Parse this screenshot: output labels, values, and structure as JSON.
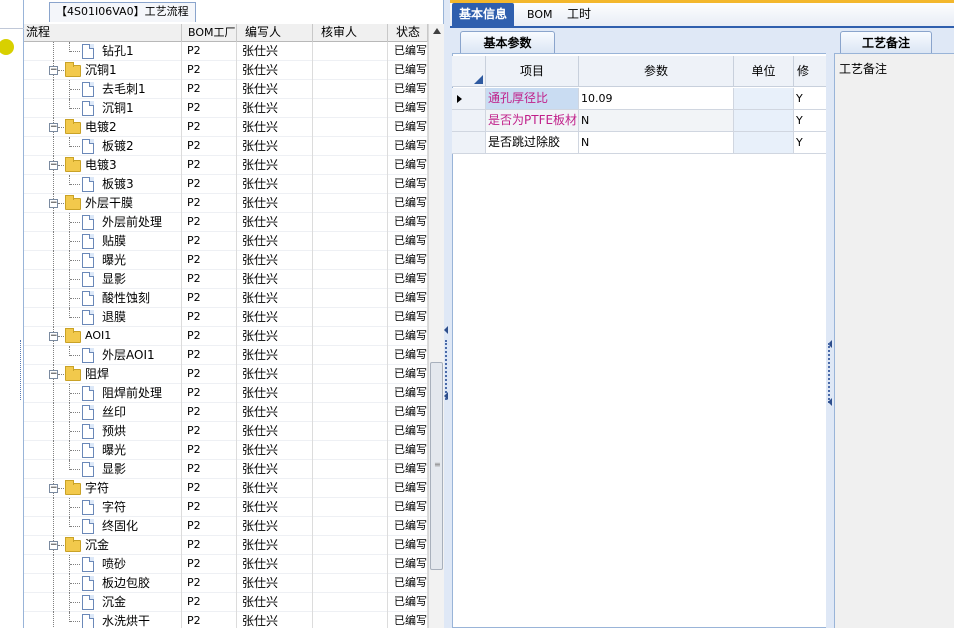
{
  "tree": {
    "tab_title": "【4S01I06VA0】工艺流程",
    "columns": {
      "flow": "流程",
      "bom": "BOM工厂",
      "writer": "编写人",
      "reviewer": "核审人",
      "status": "状态"
    },
    "rows": [
      {
        "label": "钻孔1",
        "level": 2,
        "type": "doc",
        "bom": "P2",
        "writer": "张仕兴",
        "reviewer": "",
        "status": "已编写",
        "latin": false
      },
      {
        "label": "沉铜1",
        "level": 1,
        "type": "folder",
        "bom": "P2",
        "writer": "张仕兴",
        "reviewer": "",
        "status": "已编写",
        "latin": false
      },
      {
        "label": "去毛刺1",
        "level": 2,
        "type": "doc",
        "bom": "P2",
        "writer": "张仕兴",
        "reviewer": "",
        "status": "已编写",
        "latin": false
      },
      {
        "label": "沉铜1",
        "level": 2,
        "type": "doc",
        "bom": "P2",
        "writer": "张仕兴",
        "reviewer": "",
        "status": "已编写",
        "latin": false
      },
      {
        "label": "电镀2",
        "level": 1,
        "type": "folder",
        "bom": "P2",
        "writer": "张仕兴",
        "reviewer": "",
        "status": "已编写",
        "latin": false
      },
      {
        "label": "板镀2",
        "level": 2,
        "type": "doc",
        "bom": "P2",
        "writer": "张仕兴",
        "reviewer": "",
        "status": "已编写",
        "latin": false
      },
      {
        "label": "电镀3",
        "level": 1,
        "type": "folder",
        "bom": "P2",
        "writer": "张仕兴",
        "reviewer": "",
        "status": "已编写",
        "latin": false
      },
      {
        "label": "板镀3",
        "level": 2,
        "type": "doc",
        "bom": "P2",
        "writer": "张仕兴",
        "reviewer": "",
        "status": "已编写",
        "latin": false
      },
      {
        "label": "外层干膜",
        "level": 1,
        "type": "folder",
        "bom": "P2",
        "writer": "张仕兴",
        "reviewer": "",
        "status": "已编写",
        "latin": false
      },
      {
        "label": "外层前处理",
        "level": 2,
        "type": "doc",
        "bom": "P2",
        "writer": "张仕兴",
        "reviewer": "",
        "status": "已编写",
        "latin": false
      },
      {
        "label": "贴膜",
        "level": 2,
        "type": "doc",
        "bom": "P2",
        "writer": "张仕兴",
        "reviewer": "",
        "status": "已编写",
        "latin": false
      },
      {
        "label": "曝光",
        "level": 2,
        "type": "doc",
        "bom": "P2",
        "writer": "张仕兴",
        "reviewer": "",
        "status": "已编写",
        "latin": false
      },
      {
        "label": "显影",
        "level": 2,
        "type": "doc",
        "bom": "P2",
        "writer": "张仕兴",
        "reviewer": "",
        "status": "已编写",
        "latin": false
      },
      {
        "label": "酸性蚀刻",
        "level": 2,
        "type": "doc",
        "bom": "P2",
        "writer": "张仕兴",
        "reviewer": "",
        "status": "已编写",
        "latin": false
      },
      {
        "label": "退膜",
        "level": 2,
        "type": "doc",
        "bom": "P2",
        "writer": "张仕兴",
        "reviewer": "",
        "status": "已编写",
        "latin": false
      },
      {
        "label": "AOI1",
        "level": 1,
        "type": "folder",
        "bom": "P2",
        "writer": "张仕兴",
        "reviewer": "",
        "status": "已编写",
        "latin": true
      },
      {
        "label": "外层AOI1",
        "level": 2,
        "type": "doc",
        "bom": "P2",
        "writer": "张仕兴",
        "reviewer": "",
        "status": "已编写",
        "latin": false
      },
      {
        "label": "阻焊",
        "level": 1,
        "type": "folder",
        "bom": "P2",
        "writer": "张仕兴",
        "reviewer": "",
        "status": "已编写",
        "latin": false
      },
      {
        "label": "阻焊前处理",
        "level": 2,
        "type": "doc",
        "bom": "P2",
        "writer": "张仕兴",
        "reviewer": "",
        "status": "已编写",
        "latin": false
      },
      {
        "label": "丝印",
        "level": 2,
        "type": "doc",
        "bom": "P2",
        "writer": "张仕兴",
        "reviewer": "",
        "status": "已编写",
        "latin": false
      },
      {
        "label": "预烘",
        "level": 2,
        "type": "doc",
        "bom": "P2",
        "writer": "张仕兴",
        "reviewer": "",
        "status": "已编写",
        "latin": false
      },
      {
        "label": "曝光",
        "level": 2,
        "type": "doc",
        "bom": "P2",
        "writer": "张仕兴",
        "reviewer": "",
        "status": "已编写",
        "latin": false
      },
      {
        "label": "显影",
        "level": 2,
        "type": "doc",
        "bom": "P2",
        "writer": "张仕兴",
        "reviewer": "",
        "status": "已编写",
        "latin": false
      },
      {
        "label": "字符",
        "level": 1,
        "type": "folder",
        "bom": "P2",
        "writer": "张仕兴",
        "reviewer": "",
        "status": "已编写",
        "latin": false
      },
      {
        "label": "字符",
        "level": 2,
        "type": "doc",
        "bom": "P2",
        "writer": "张仕兴",
        "reviewer": "",
        "status": "已编写",
        "latin": false
      },
      {
        "label": "终固化",
        "level": 2,
        "type": "doc",
        "bom": "P2",
        "writer": "张仕兴",
        "reviewer": "",
        "status": "已编写",
        "latin": false
      },
      {
        "label": "沉金",
        "level": 1,
        "type": "folder",
        "bom": "P2",
        "writer": "张仕兴",
        "reviewer": "",
        "status": "已编写",
        "latin": false
      },
      {
        "label": "喷砂",
        "level": 2,
        "type": "doc",
        "bom": "P2",
        "writer": "张仕兴",
        "reviewer": "",
        "status": "已编写",
        "latin": false
      },
      {
        "label": "板边包胶",
        "level": 2,
        "type": "doc",
        "bom": "P2",
        "writer": "张仕兴",
        "reviewer": "",
        "status": "已编写",
        "latin": false
      },
      {
        "label": "沉金",
        "level": 2,
        "type": "doc",
        "bom": "P2",
        "writer": "张仕兴",
        "reviewer": "",
        "status": "已编写",
        "latin": false
      },
      {
        "label": "水洗烘干",
        "level": 2,
        "type": "doc",
        "bom": "P2",
        "writer": "张仕兴",
        "reviewer": "",
        "status": "已编写",
        "latin": false
      }
    ]
  },
  "top_tabs": [
    {
      "label": "基本信息",
      "active": true
    },
    {
      "label": "BOM",
      "active": false
    },
    {
      "label": "工时",
      "active": false
    }
  ],
  "params": {
    "subtab": "基本参数",
    "columns": {
      "item": "项目",
      "param": "参数",
      "unit": "单位",
      "mod": "修"
    },
    "rows": [
      {
        "item": "通孔厚径比",
        "param": "10.09",
        "unit": "",
        "mod": "Y",
        "pink": true,
        "highlight": true,
        "current": true
      },
      {
        "item": "是否为PTFE板材",
        "param": "N",
        "unit": "",
        "mod": "Y",
        "pink": true,
        "highlight": false,
        "current": false
      },
      {
        "item": "是否跳过除胶",
        "param": "N",
        "unit": "",
        "mod": "Y",
        "pink": false,
        "highlight": false,
        "current": false
      }
    ]
  },
  "notes": {
    "subtab": "工艺备注",
    "label": "工艺备注"
  },
  "colors": {
    "accent": "#2f5fae",
    "pink_text": "#c0208a",
    "folder": "#f2c94c",
    "top_bar": "#f3b72c"
  }
}
